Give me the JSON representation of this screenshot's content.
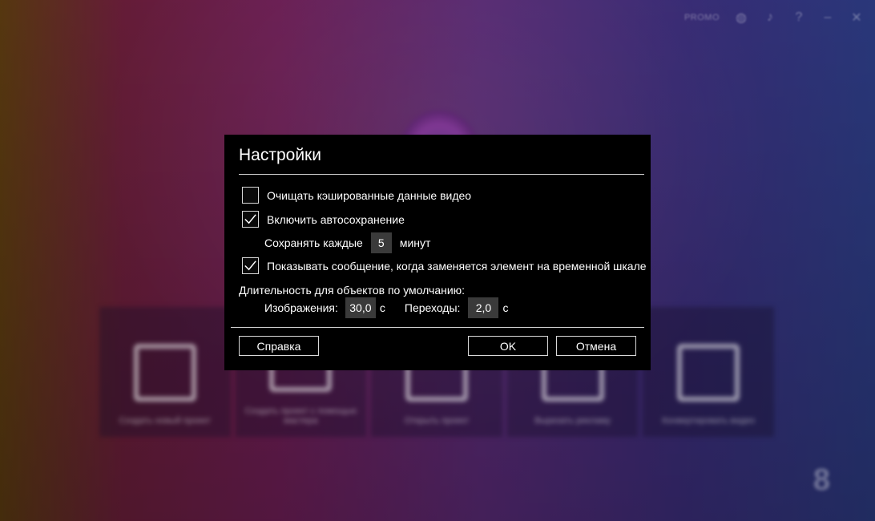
{
  "background_app": {
    "top_bar": {
      "promo_label": "PROMO",
      "icons": [
        "globe-icon",
        "music-note-icon",
        "help-icon",
        "minimize-icon",
        "close-icon"
      ]
    },
    "tiles": [
      {
        "label": "Создать новый проект",
        "icon": "clapperboard-icon"
      },
      {
        "label": "Создать проект с помощью мастера",
        "icon": "wizard-icon"
      },
      {
        "label": "Открыть проект",
        "icon": "open-project-icon"
      },
      {
        "label": "Вырезать рекламу",
        "icon": "scissors-icon"
      },
      {
        "label": "Конвертировать видео",
        "icon": "convert-files-icon"
      }
    ]
  },
  "dialog": {
    "title": "Настройки",
    "options": {
      "clear_cache": {
        "label": "Очищать кэшированные данные видео",
        "checked": false
      },
      "autosave": {
        "label": "Включить автосохранение",
        "checked": true
      },
      "autosave_interval": {
        "prefix": "Сохранять каждые",
        "value": "5",
        "suffix": "минут"
      },
      "timeline_message": {
        "label": "Показывать сообщение, когда заменяется элемент на временной шкале",
        "checked": true
      }
    },
    "duration": {
      "heading": "Длительность для объектов по умолчанию:",
      "images_label": "Изображения:",
      "images_value": "30,0",
      "images_unit": "с",
      "transitions_label": "Переходы:",
      "transitions_value": "2,0",
      "transitions_unit": "с"
    },
    "buttons": {
      "help": "Справка",
      "ok": "OK",
      "cancel": "Отмена"
    }
  }
}
